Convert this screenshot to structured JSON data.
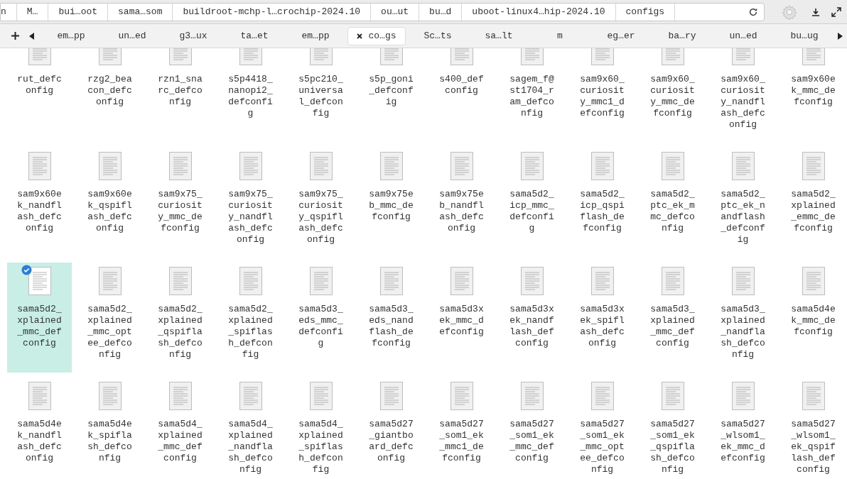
{
  "path_bar": {
    "crumbs": [
      "n",
      "M…",
      "bui…oot",
      "sama…som",
      "buildroot-mchp-l…crochip-2024.10",
      "ou…ut",
      "bu…d",
      "uboot-linux4…hip-2024.10",
      "configs"
    ]
  },
  "tabs": [
    {
      "label": "em…pp",
      "selected": false
    },
    {
      "label": "un…ed",
      "selected": false
    },
    {
      "label": "g3…ux",
      "selected": false
    },
    {
      "label": "ta…et",
      "selected": false
    },
    {
      "label": "em…pp",
      "selected": false
    },
    {
      "label": "co…gs",
      "selected": true
    },
    {
      "label": "Sc…ts",
      "selected": false
    },
    {
      "label": "sa…lt",
      "selected": false
    },
    {
      "label": "m",
      "selected": false
    },
    {
      "label": "eg…er",
      "selected": false
    },
    {
      "label": "ba…ry",
      "selected": false
    },
    {
      "label": "un…ed",
      "selected": false
    },
    {
      "label": "bu…ug",
      "selected": false
    }
  ],
  "files": [
    {
      "name": "rut_defconfig",
      "selected": false
    },
    {
      "name": "rzg2_beacon_defconfig",
      "selected": false
    },
    {
      "name": "rzn1_snarc_defconfig",
      "selected": false
    },
    {
      "name": "s5p4418_nanopi2_defconfig",
      "selected": false
    },
    {
      "name": "s5pc210_universal_defconfig",
      "selected": false
    },
    {
      "name": "s5p_goni_defconfig",
      "selected": false
    },
    {
      "name": "s400_defconfig",
      "selected": false
    },
    {
      "name": "sagem_f@st1704_ram_defconfig",
      "selected": false
    },
    {
      "name": "sam9x60_curiosity_mmc1_defconfig",
      "selected": false
    },
    {
      "name": "sam9x60_curiosity_mmc_defconfig",
      "selected": false
    },
    {
      "name": "sam9x60_curiosity_nandflash_defconfig",
      "selected": false
    },
    {
      "name": "sam9x60ek_mmc_defconfig",
      "selected": false
    },
    {
      "name": "sam9x60ek_nandflash_defconfig",
      "selected": false
    },
    {
      "name": "sam9x60ek_qspiflash_defconfig",
      "selected": false
    },
    {
      "name": "sam9x75_curiosity_mmc_defconfig",
      "selected": false
    },
    {
      "name": "sam9x75_curiosity_nandflash_defconfig",
      "selected": false
    },
    {
      "name": "sam9x75_curiosity_qspiflash_defconfig",
      "selected": false
    },
    {
      "name": "sam9x75eb_mmc_defconfig",
      "selected": false
    },
    {
      "name": "sam9x75eb_nandflash_defconfig",
      "selected": false
    },
    {
      "name": "sama5d2_icp_mmc_defconfig",
      "selected": false
    },
    {
      "name": "sama5d2_icp_qspiflash_defconfig",
      "selected": false
    },
    {
      "name": "sama5d2_ptc_ek_mmc_defconfig",
      "selected": false
    },
    {
      "name": "sama5d2_ptc_ek_nandflash_defconfig",
      "selected": false
    },
    {
      "name": "sama5d2_xplained_emmc_defconfig",
      "selected": false
    },
    {
      "name": "sama5d2_xplained_mmc_defconfig",
      "selected": true
    },
    {
      "name": "sama5d2_xplained_mmc_optee_defconfig",
      "selected": false
    },
    {
      "name": "sama5d2_xplained_qspiflash_defconfig",
      "selected": false
    },
    {
      "name": "sama5d2_xplained_spiflash_defconfig",
      "selected": false
    },
    {
      "name": "sama5d3_eds_mmc_defconfig",
      "selected": false
    },
    {
      "name": "sama5d3_eds_nandflash_defconfig",
      "selected": false
    },
    {
      "name": "sama5d3xek_mmc_defconfig",
      "selected": false
    },
    {
      "name": "sama5d3xek_nandflash_defconfig",
      "selected": false
    },
    {
      "name": "sama5d3xek_spiflash_defconfig",
      "selected": false
    },
    {
      "name": "sama5d3_xplained_mmc_defconfig",
      "selected": false
    },
    {
      "name": "sama5d3_xplained_nandflash_defconfig",
      "selected": false
    },
    {
      "name": "sama5d4ek_mmc_defconfig",
      "selected": false
    },
    {
      "name": "sama5d4ek_nandflash_defconfig",
      "selected": false
    },
    {
      "name": "sama5d4ek_spiflash_defconfig",
      "selected": false
    },
    {
      "name": "sama5d4_xplained_mmc_defconfig",
      "selected": false
    },
    {
      "name": "sama5d4_xplained_nandflash_defconfig",
      "selected": false
    },
    {
      "name": "sama5d4_xplained_spiflash_defconfig",
      "selected": false
    },
    {
      "name": "sama5d27_giantboard_defconfig",
      "selected": false
    },
    {
      "name": "sama5d27_som1_ek_mmc1_defconfig",
      "selected": false
    },
    {
      "name": "sama5d27_som1_ek_mmc_defconfig",
      "selected": false
    },
    {
      "name": "sama5d27_som1_ek_mmc_optee_defconfig",
      "selected": false
    },
    {
      "name": "sama5d27_som1_ek_qspiflash_defconfig",
      "selected": false
    },
    {
      "name": "sama5d27_wlsom1_ek_mmc_defconfig",
      "selected": false
    },
    {
      "name": "sama5d27_wlsom1_ek_qspiflash_defconfig",
      "selected": false
    }
  ]
}
